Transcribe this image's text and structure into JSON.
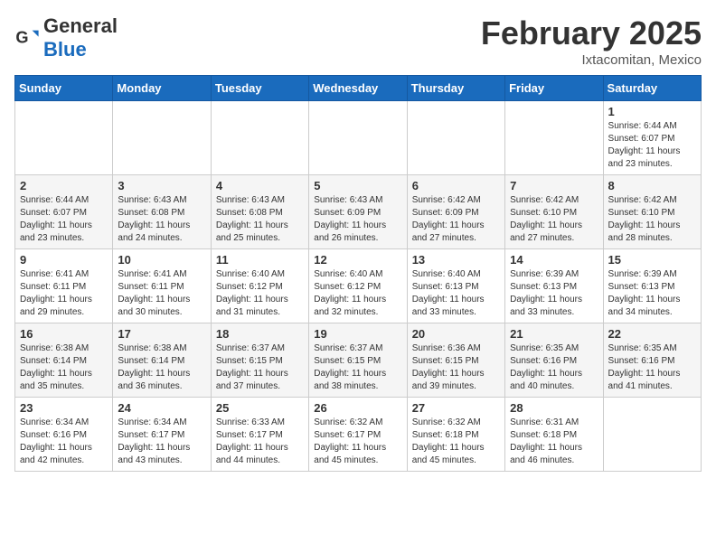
{
  "header": {
    "logo_general": "General",
    "logo_blue": "Blue",
    "month_title": "February 2025",
    "subtitle": "Ixtacomitan, Mexico"
  },
  "weekdays": [
    "Sunday",
    "Monday",
    "Tuesday",
    "Wednesday",
    "Thursday",
    "Friday",
    "Saturday"
  ],
  "weeks": [
    [
      {
        "day": "",
        "info": ""
      },
      {
        "day": "",
        "info": ""
      },
      {
        "day": "",
        "info": ""
      },
      {
        "day": "",
        "info": ""
      },
      {
        "day": "",
        "info": ""
      },
      {
        "day": "",
        "info": ""
      },
      {
        "day": "1",
        "info": "Sunrise: 6:44 AM\nSunset: 6:07 PM\nDaylight: 11 hours and 23 minutes."
      }
    ],
    [
      {
        "day": "2",
        "info": "Sunrise: 6:44 AM\nSunset: 6:07 PM\nDaylight: 11 hours and 23 minutes."
      },
      {
        "day": "3",
        "info": "Sunrise: 6:43 AM\nSunset: 6:08 PM\nDaylight: 11 hours and 24 minutes."
      },
      {
        "day": "4",
        "info": "Sunrise: 6:43 AM\nSunset: 6:08 PM\nDaylight: 11 hours and 25 minutes."
      },
      {
        "day": "5",
        "info": "Sunrise: 6:43 AM\nSunset: 6:09 PM\nDaylight: 11 hours and 26 minutes."
      },
      {
        "day": "6",
        "info": "Sunrise: 6:42 AM\nSunset: 6:09 PM\nDaylight: 11 hours and 27 minutes."
      },
      {
        "day": "7",
        "info": "Sunrise: 6:42 AM\nSunset: 6:10 PM\nDaylight: 11 hours and 27 minutes."
      },
      {
        "day": "8",
        "info": "Sunrise: 6:42 AM\nSunset: 6:10 PM\nDaylight: 11 hours and 28 minutes."
      }
    ],
    [
      {
        "day": "9",
        "info": "Sunrise: 6:41 AM\nSunset: 6:11 PM\nDaylight: 11 hours and 29 minutes."
      },
      {
        "day": "10",
        "info": "Sunrise: 6:41 AM\nSunset: 6:11 PM\nDaylight: 11 hours and 30 minutes."
      },
      {
        "day": "11",
        "info": "Sunrise: 6:40 AM\nSunset: 6:12 PM\nDaylight: 11 hours and 31 minutes."
      },
      {
        "day": "12",
        "info": "Sunrise: 6:40 AM\nSunset: 6:12 PM\nDaylight: 11 hours and 32 minutes."
      },
      {
        "day": "13",
        "info": "Sunrise: 6:40 AM\nSunset: 6:13 PM\nDaylight: 11 hours and 33 minutes."
      },
      {
        "day": "14",
        "info": "Sunrise: 6:39 AM\nSunset: 6:13 PM\nDaylight: 11 hours and 33 minutes."
      },
      {
        "day": "15",
        "info": "Sunrise: 6:39 AM\nSunset: 6:13 PM\nDaylight: 11 hours and 34 minutes."
      }
    ],
    [
      {
        "day": "16",
        "info": "Sunrise: 6:38 AM\nSunset: 6:14 PM\nDaylight: 11 hours and 35 minutes."
      },
      {
        "day": "17",
        "info": "Sunrise: 6:38 AM\nSunset: 6:14 PM\nDaylight: 11 hours and 36 minutes."
      },
      {
        "day": "18",
        "info": "Sunrise: 6:37 AM\nSunset: 6:15 PM\nDaylight: 11 hours and 37 minutes."
      },
      {
        "day": "19",
        "info": "Sunrise: 6:37 AM\nSunset: 6:15 PM\nDaylight: 11 hours and 38 minutes."
      },
      {
        "day": "20",
        "info": "Sunrise: 6:36 AM\nSunset: 6:15 PM\nDaylight: 11 hours and 39 minutes."
      },
      {
        "day": "21",
        "info": "Sunrise: 6:35 AM\nSunset: 6:16 PM\nDaylight: 11 hours and 40 minutes."
      },
      {
        "day": "22",
        "info": "Sunrise: 6:35 AM\nSunset: 6:16 PM\nDaylight: 11 hours and 41 minutes."
      }
    ],
    [
      {
        "day": "23",
        "info": "Sunrise: 6:34 AM\nSunset: 6:16 PM\nDaylight: 11 hours and 42 minutes."
      },
      {
        "day": "24",
        "info": "Sunrise: 6:34 AM\nSunset: 6:17 PM\nDaylight: 11 hours and 43 minutes."
      },
      {
        "day": "25",
        "info": "Sunrise: 6:33 AM\nSunset: 6:17 PM\nDaylight: 11 hours and 44 minutes."
      },
      {
        "day": "26",
        "info": "Sunrise: 6:32 AM\nSunset: 6:17 PM\nDaylight: 11 hours and 45 minutes."
      },
      {
        "day": "27",
        "info": "Sunrise: 6:32 AM\nSunset: 6:18 PM\nDaylight: 11 hours and 45 minutes."
      },
      {
        "day": "28",
        "info": "Sunrise: 6:31 AM\nSunset: 6:18 PM\nDaylight: 11 hours and 46 minutes."
      },
      {
        "day": "",
        "info": ""
      }
    ]
  ]
}
